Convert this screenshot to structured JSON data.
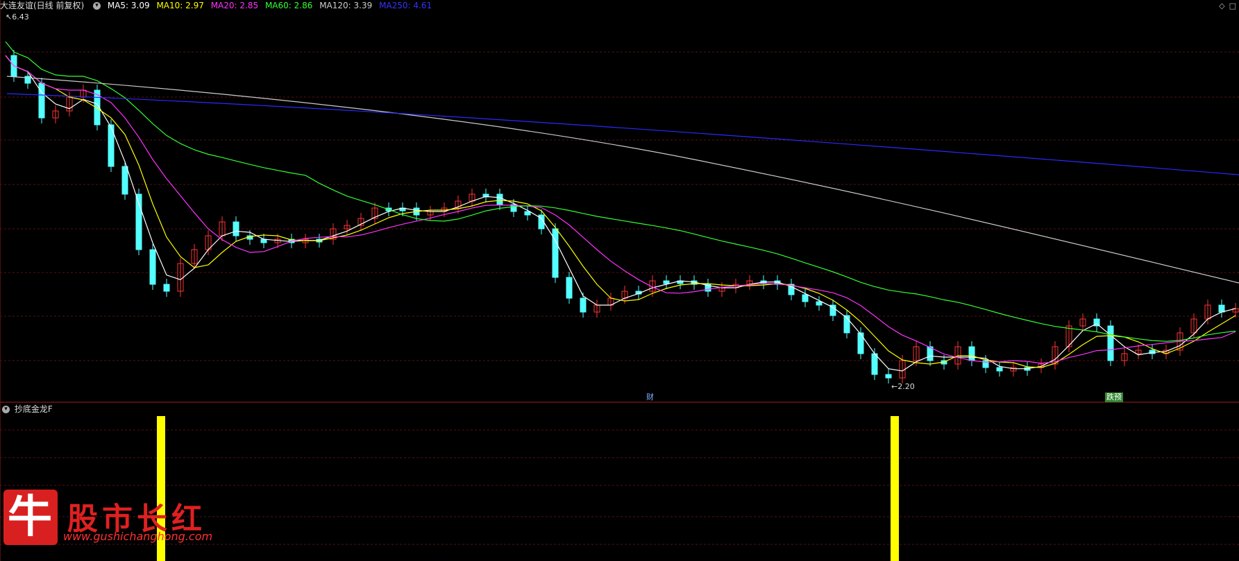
{
  "header": {
    "stock": "大连友谊(日线 前复权)",
    "ma": [
      {
        "label": "MA5: 3.09",
        "color": "#ffffff"
      },
      {
        "label": "MA10: 2.97",
        "color": "#ffff00"
      },
      {
        "label": "MA20: 2.85",
        "color": "#ff33ff"
      },
      {
        "label": "MA60: 2.86",
        "color": "#33ff33"
      },
      {
        "label": "MA120: 3.39",
        "color": "#cccccc"
      },
      {
        "label": "MA250: 4.61",
        "color": "#3333ff"
      }
    ]
  },
  "price_chart": {
    "high_label": "6.43",
    "low_label": "2.20",
    "event_badges": [
      "财",
      "跌预"
    ]
  },
  "indicator": {
    "name": "抄底金龙F"
  },
  "watermark": {
    "logo_char": "牛",
    "text": "股市长红",
    "url": "www.gushichanghong.com"
  },
  "colors": {
    "up": "#ff3333",
    "down": "#54ffff",
    "signal": "#ffff00"
  }
}
